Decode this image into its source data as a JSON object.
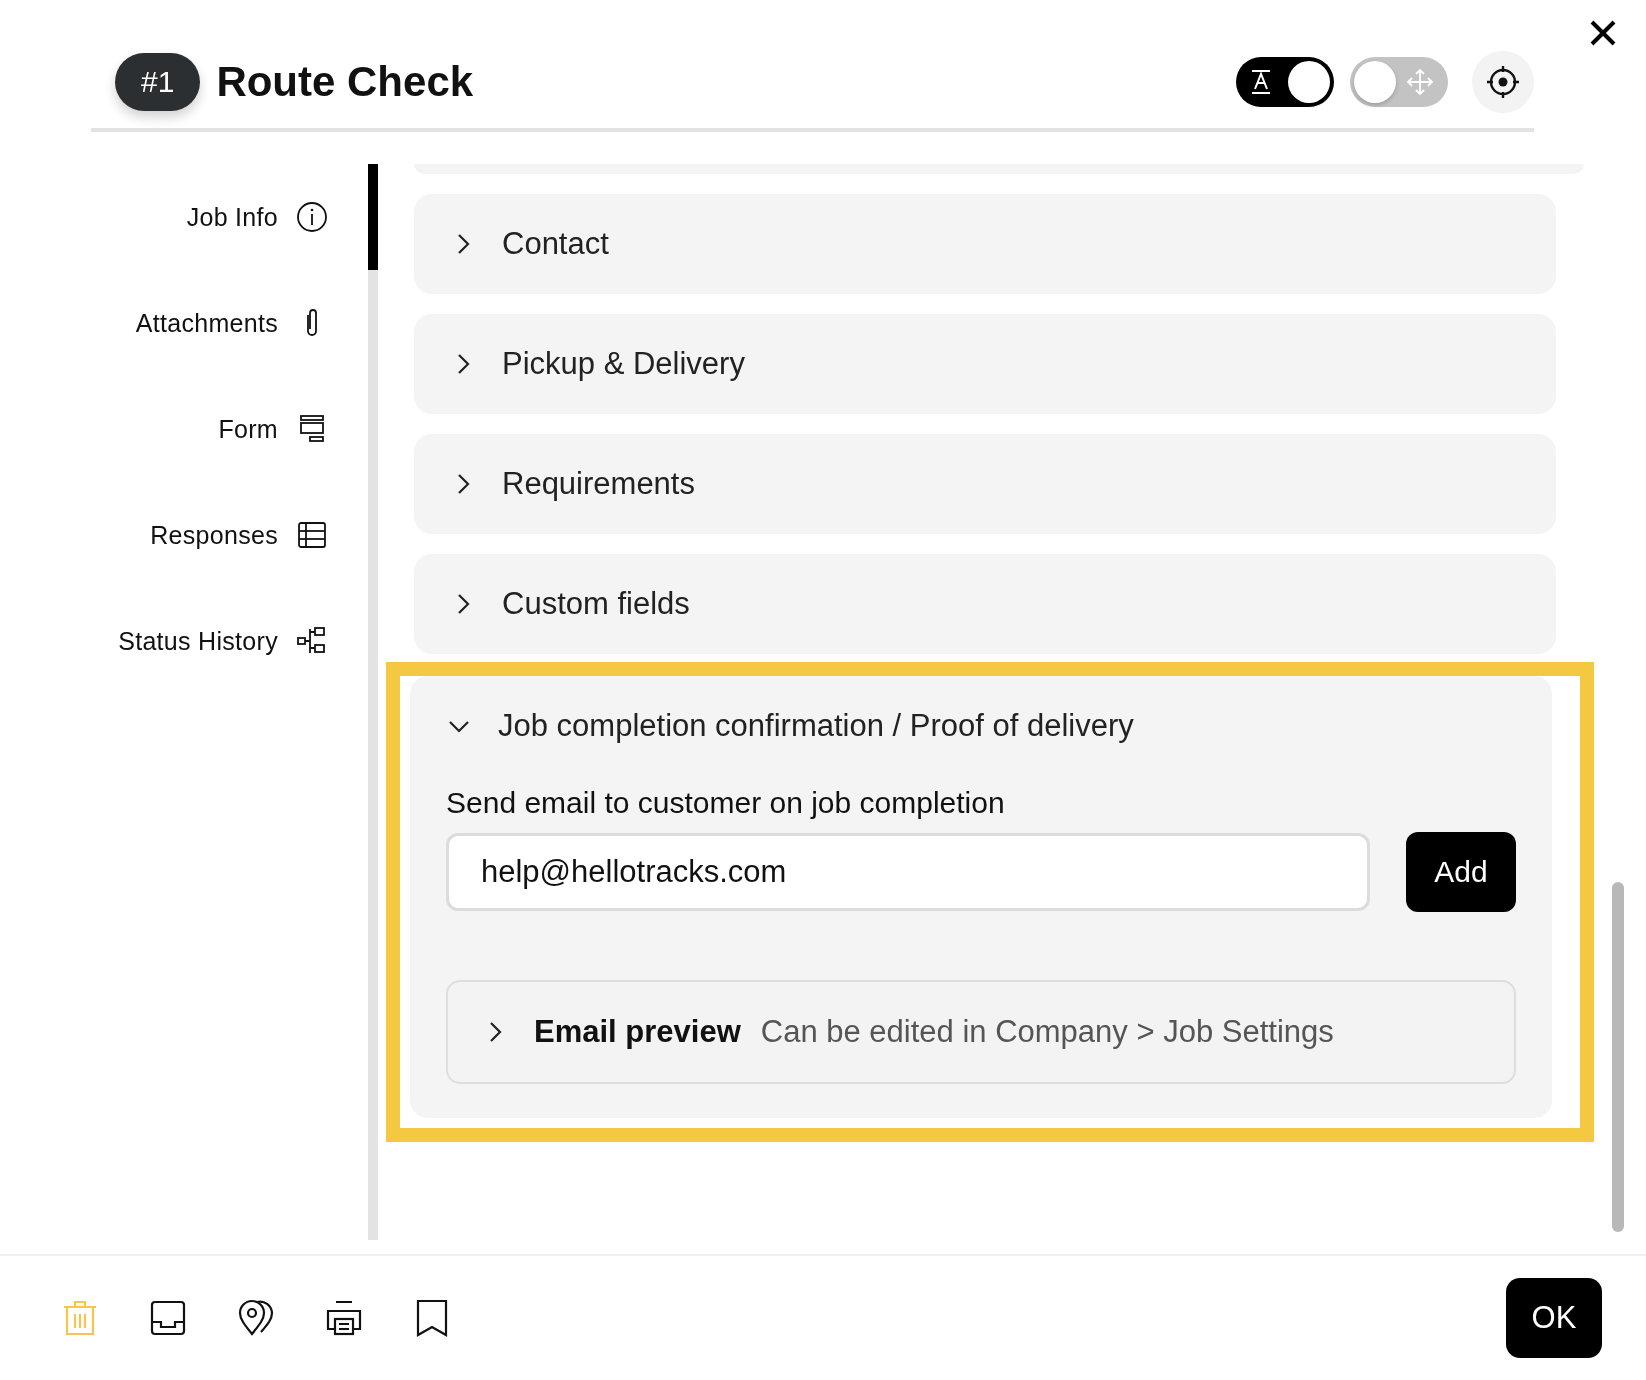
{
  "header": {
    "number": "#1",
    "title": "Route Check",
    "toggles": [
      {
        "kind": "text",
        "on": true
      },
      {
        "kind": "move",
        "on": false
      }
    ]
  },
  "sidebar": {
    "items": [
      {
        "label": "Job Info"
      },
      {
        "label": "Attachments"
      },
      {
        "label": "Form"
      },
      {
        "label": "Responses"
      },
      {
        "label": "Status History"
      }
    ]
  },
  "sections": [
    {
      "title": "Contact",
      "expanded": false,
      "highlighted": false
    },
    {
      "title": "Pickup & Delivery",
      "expanded": false,
      "highlighted": false
    },
    {
      "title": "Requirements",
      "expanded": false,
      "highlighted": false
    },
    {
      "title": "Custom fields",
      "expanded": false,
      "highlighted": false
    },
    {
      "title": "Job completion confirmation / Proof of delivery",
      "expanded": true,
      "highlighted": true,
      "email_label": "Send email to customer on job completion",
      "email_value": "help@hellotracks.com",
      "add_button": "Add",
      "preview": {
        "title": "Email preview",
        "note": "Can be edited in Company > Job Settings",
        "expanded": false
      }
    }
  ],
  "footer": {
    "tools": [
      {
        "color": "#f5c64e"
      },
      {
        "color": "#111111"
      },
      {
        "color": "#111111"
      },
      {
        "color": "#111111"
      },
      {
        "color": "#111111"
      }
    ],
    "ok_button": "OK"
  }
}
